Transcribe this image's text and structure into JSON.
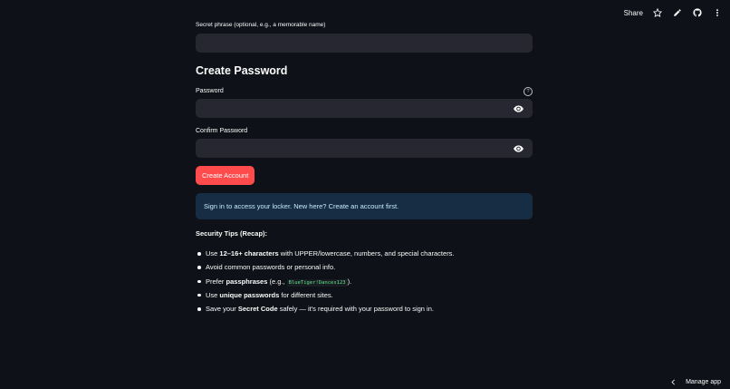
{
  "toolbar": {
    "share_label": "Share",
    "icons": [
      "star-icon",
      "pencil-icon",
      "github-icon",
      "more-vertical-icon"
    ]
  },
  "form": {
    "secret_label": "Secret phrase (optional, e.g., a memorable name)",
    "secret_value": "",
    "heading": "Create Password",
    "password_label": "Password",
    "password_value": "",
    "confirm_label": "Confirm Password",
    "confirm_value": "",
    "help_icon": "?",
    "create_button": "Create Account"
  },
  "info_message": "Sign in to access your locker. New here? Create an account first.",
  "tips": {
    "title": "Security Tips (Recap):",
    "items": [
      {
        "pre": "Use ",
        "bold": "12–16+ characters",
        "post": " with UPPER/lowercase, numbers, and special characters."
      },
      {
        "text": "Avoid common passwords or personal info."
      },
      {
        "pre": "Prefer ",
        "bold": "passphrases",
        "mid": " (e.g., ",
        "code": "BlueTiger!Dances123",
        "post": ")."
      },
      {
        "pre": "Use ",
        "bold": "unique passwords",
        "post": " for different sites."
      },
      {
        "pre": "Save your ",
        "bold": "Secret Code",
        "post": " safely — it's required with your password to sign in."
      }
    ]
  },
  "footer": {
    "manage_label": "Manage app"
  },
  "colors": {
    "background": "#0e1117",
    "input": "#262730",
    "primary": "#ff4b4b",
    "info_bg": "#172d43",
    "code": "#5ce488"
  }
}
